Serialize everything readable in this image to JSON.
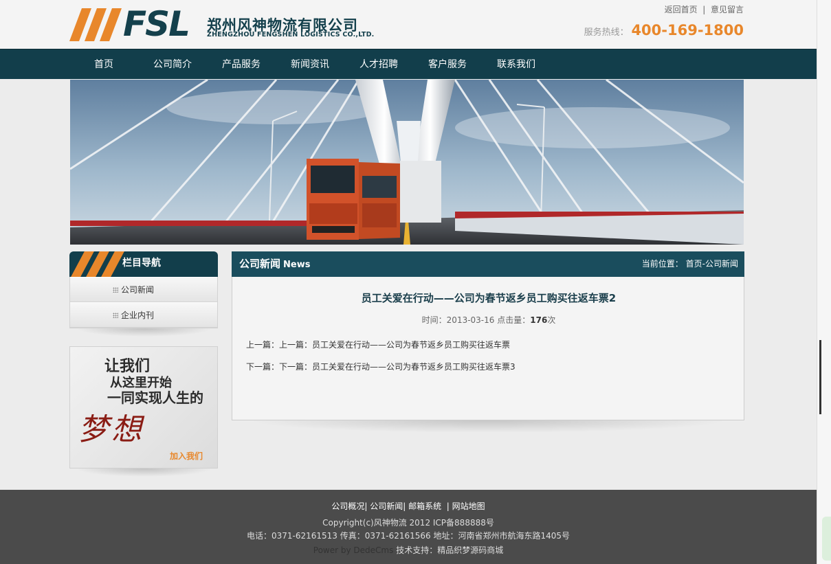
{
  "header": {
    "logo_mark": "FSL",
    "company_cn": "郑州风神物流有限公司",
    "company_en": "ZHENGZHOU FENGSHEN LOGISTICS CO.,LTD.",
    "toplinks": {
      "home": "返回首页",
      "sep": "|",
      "feedback": "意见留言"
    },
    "hotline_label": "服务热线：",
    "hotline_number": "400-169-1800"
  },
  "nav": {
    "items": [
      {
        "label": "首页"
      },
      {
        "label": "公司简介"
      },
      {
        "label": "产品服务"
      },
      {
        "label": "新闻资讯"
      },
      {
        "label": "人才招聘"
      },
      {
        "label": "客户服务"
      },
      {
        "label": "联系我们"
      }
    ]
  },
  "sidebar": {
    "title": "栏目导航",
    "items": [
      {
        "label": "公司新闻"
      },
      {
        "label": "企业内刊"
      }
    ],
    "join_banner": {
      "line1": "让我们",
      "line2": "从这里开始",
      "line3": "一同实现人生的",
      "dream": "梦想",
      "button": "加入我们"
    }
  },
  "main": {
    "title_cn": "公司新闻",
    "title_en": "News",
    "breadcrumb_label": "当前位置：",
    "breadcrumb_home": "首页",
    "breadcrumb_sep": "-",
    "breadcrumb_current": "公司新闻",
    "article": {
      "title": "员工关爱在行动——公司为春节返乡员工购买往返车票2",
      "time_label": "时间：",
      "time": "2013-03-16",
      "clicks_label": "点击量：",
      "clicks": "176",
      "clicks_unit": "次",
      "prev_label": "上一篇：",
      "prev_link": "上一篇：员工关爱在行动——公司为春节返乡员工购买往返车票",
      "next_label": "下一篇：",
      "next_link": "下一篇：员工关爱在行动——公司为春节返乡员工购买往返车票3"
    }
  },
  "footer": {
    "links": [
      "公司概况",
      "公司新闻",
      "邮箱系统",
      "网站地图"
    ],
    "copyright": "Copyright(c)风神物流  2012 ICP备888888号",
    "contact": "电话：0371-62161513 传真：0371-62161566 地址：河南省郑州市航海东路1405号",
    "powered": "Power by DedeCms",
    "support": "技术支持：精品织梦源码商城"
  },
  "colors": {
    "brand_dark": "#123e4b",
    "brand_orange": "#e8872b",
    "footer_bg": "#4b4b4b"
  }
}
